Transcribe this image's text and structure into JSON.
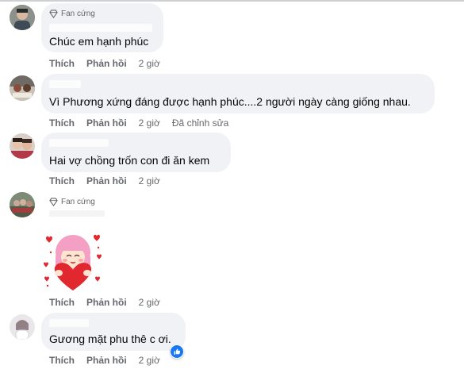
{
  "comments": [
    {
      "badge": "Fan cứng",
      "text": "Chúc em hạnh phúc",
      "actions": {
        "like": "Thích",
        "reply": "Phản hồi",
        "time": "2 giờ"
      }
    },
    {
      "text": "Vì Phương xứng đáng được hạnh phúc....2 người ngày càng giống nhau.",
      "actions": {
        "like": "Thích",
        "reply": "Phản hồi",
        "time": "2 giờ",
        "edited": "Đã chỉnh sửa"
      }
    },
    {
      "text": "Hai vợ chồng trốn con đi ăn kem",
      "actions": {
        "like": "Thích",
        "reply": "Phản hồi",
        "time": "2 giờ"
      }
    },
    {
      "badge": "Fan cứng",
      "sticker": "heart-hug-sticker",
      "actions": {
        "like": "Thích",
        "reply": "Phản hồi",
        "time": "2 giờ"
      }
    },
    {
      "text": "Gương mặt phu thê c ơi.",
      "reaction": "like-reaction-icon",
      "actions": {
        "like": "Thích",
        "reply": "Phản hồi",
        "time": "2 giờ"
      }
    }
  ],
  "colors": {
    "bubble": "#f0f2f5",
    "meta": "#65676b",
    "text": "#050505",
    "like_blue": "#1877f2",
    "sticker_heart": "#e0282e",
    "sticker_hair": "#f4a0c4"
  },
  "icons": {
    "badge": "diamond-icon"
  }
}
